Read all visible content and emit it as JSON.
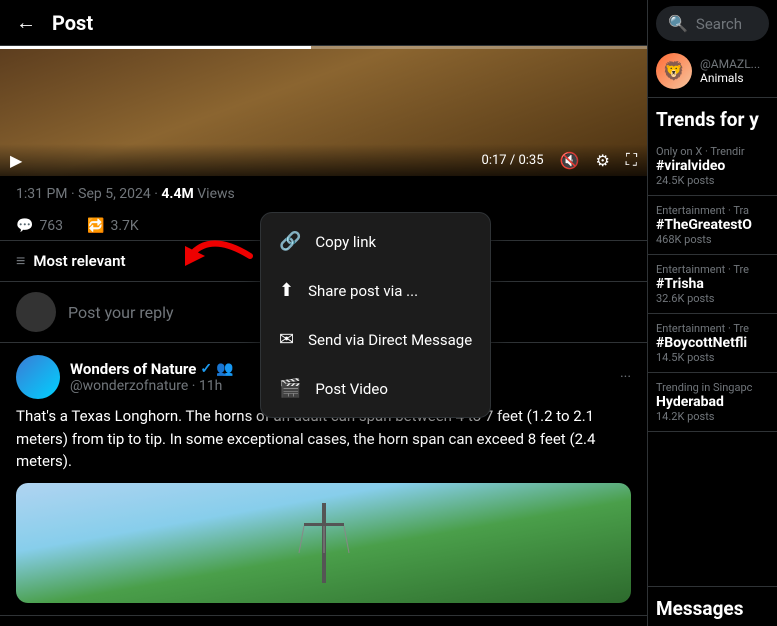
{
  "header": {
    "back_label": "←",
    "title": "Post"
  },
  "video": {
    "progress_pct": 48,
    "time_current": "0:17",
    "time_total": "0:35"
  },
  "post_meta": {
    "time": "1:31 PM · Sep 5, 2024",
    "separator": "·",
    "views": "4.4M",
    "views_label": "Views"
  },
  "actions": {
    "comments": "763",
    "retweets": "3.7K"
  },
  "context_menu": {
    "items": [
      {
        "id": "copy-link",
        "label": "Copy link",
        "icon": "🔗"
      },
      {
        "id": "share-post",
        "label": "Share post via ...",
        "icon": "↑"
      },
      {
        "id": "send-dm",
        "label": "Send via Direct Message",
        "icon": "✉"
      },
      {
        "id": "post-video",
        "label": "Post Video",
        "icon": "🎬"
      }
    ]
  },
  "filter": {
    "icon": "≡",
    "label": "Most relevant"
  },
  "reply_input": {
    "placeholder": "Post your reply"
  },
  "reply_card": {
    "display_name": "Wonders of Nature",
    "handle": "@wonderzofnature",
    "time": "11h",
    "verified": true,
    "group": true,
    "text": "That's a Texas Longhorn. The horns of an adult can span between 4 to 7 feet (1.2 to 2.1 meters) from tip to tip. In some exceptional cases, the horn span can exceed 8 feet (2.4 meters)."
  },
  "right_panel": {
    "search": {
      "placeholder": "Search"
    },
    "profile": {
      "handle": "@AMAZL...",
      "desc": "Animals"
    },
    "trends_header": "Trends for y",
    "trends": [
      {
        "category": "Only on X · Trendir",
        "name": "#viralvideo",
        "posts": "24.5K posts"
      },
      {
        "category": "Entertainment · Tra",
        "name": "#TheGreatestO",
        "posts": "468K posts"
      },
      {
        "category": "Entertainment · Tre",
        "name": "#Trisha",
        "posts": "32.6K posts"
      },
      {
        "category": "Entertainment · Tre",
        "name": "#BoycottNetfli",
        "posts": "14.5K posts"
      },
      {
        "category": "Trending in Singapc",
        "name": "Hyderabad",
        "posts": "14.2K posts"
      }
    ],
    "messages_header": "Messages"
  }
}
